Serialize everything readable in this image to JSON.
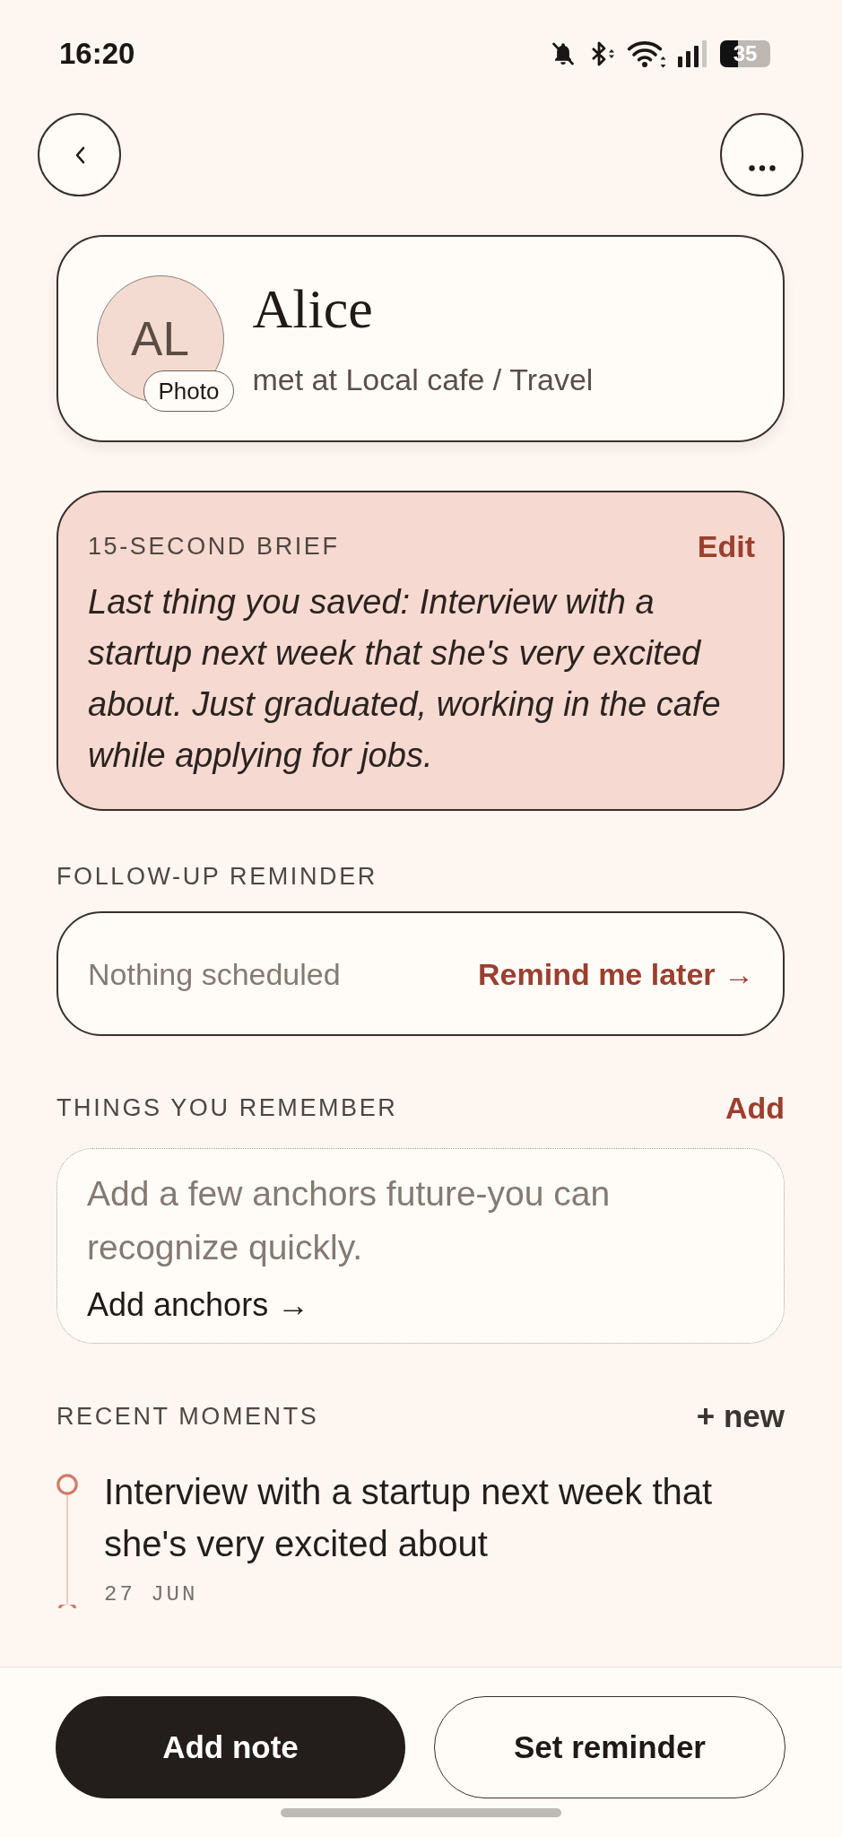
{
  "status_bar": {
    "time": "16:20",
    "battery": "35"
  },
  "contact": {
    "initials": "AL",
    "photo_button": "Photo",
    "name": "Alice",
    "subtitle": "met at Local cafe / Travel"
  },
  "brief": {
    "label": "15-SECOND BRIEF",
    "edit": "Edit",
    "text": "Last thing you saved: Interview with a startup next week that she's very excited about. Just graduated, working in the cafe while applying for jobs."
  },
  "follow_up": {
    "label": "FOLLOW-UP REMINDER",
    "status": "Nothing scheduled",
    "action": "Remind me later →"
  },
  "things": {
    "label": "THINGS YOU REMEMBER",
    "add": "Add",
    "empty_text": "Add a few anchors future-you can recognize quickly.",
    "link": "Add anchors →"
  },
  "recent_moments": {
    "label": "RECENT MOMENTS",
    "new": "+ new",
    "items": [
      {
        "text": "Interview with a startup next week that she's very excited about",
        "date": "27 JUN"
      }
    ]
  },
  "actions": [
    {
      "label": "Add note",
      "kind": "primary"
    },
    {
      "label": "Set reminder",
      "kind": "secondary"
    }
  ]
}
